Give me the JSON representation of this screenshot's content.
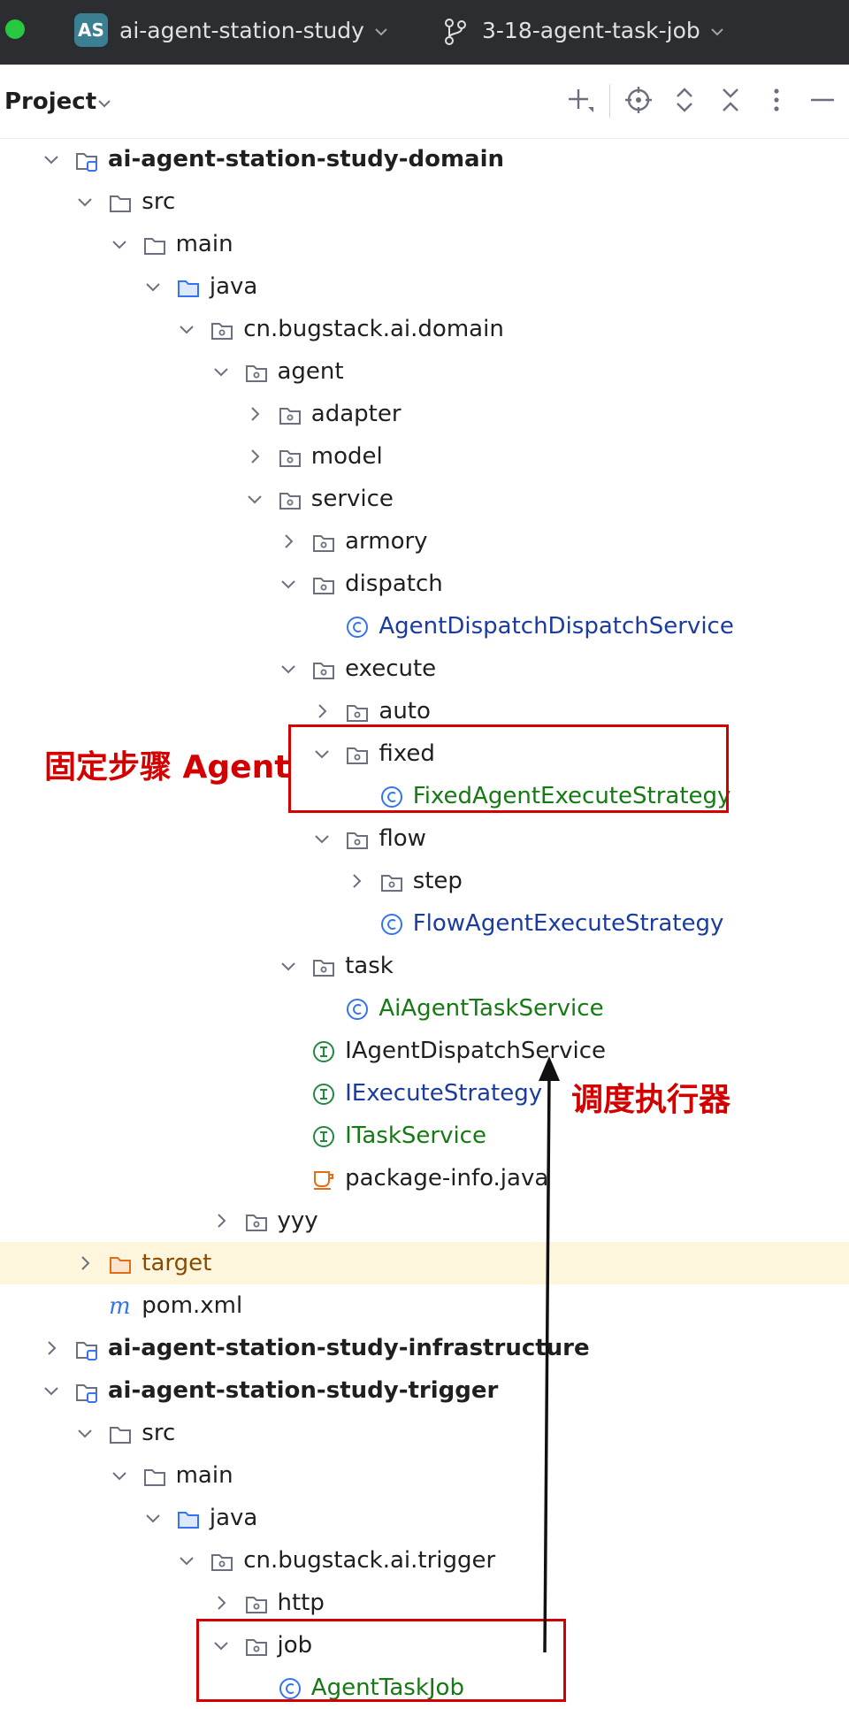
{
  "titlebar": {
    "project_badge": "AS",
    "project_name": "ai-agent-station-study",
    "branch_name": "3-18-agent-task-job"
  },
  "toolbar": {
    "title": "Project",
    "icons": [
      "add-icon",
      "locate-icon",
      "expand-all-icon",
      "collapse-all-icon",
      "more-icon",
      "minimize-icon"
    ]
  },
  "tree": [
    {
      "label": "ai-agent-station-study-domain",
      "depth": 0,
      "expanded": true,
      "icon": "module",
      "style": "bold"
    },
    {
      "label": "src",
      "depth": 1,
      "expanded": true,
      "icon": "folder"
    },
    {
      "label": "main",
      "depth": 2,
      "expanded": true,
      "icon": "folder"
    },
    {
      "label": "java",
      "depth": 3,
      "expanded": true,
      "icon": "source-folder"
    },
    {
      "label": "cn.bugstack.ai.domain",
      "depth": 4,
      "expanded": true,
      "icon": "package"
    },
    {
      "label": "agent",
      "depth": 5,
      "expanded": true,
      "icon": "package"
    },
    {
      "label": "adapter",
      "depth": 6,
      "expanded": false,
      "icon": "package"
    },
    {
      "label": "model",
      "depth": 6,
      "expanded": false,
      "icon": "package"
    },
    {
      "label": "service",
      "depth": 6,
      "expanded": true,
      "icon": "package"
    },
    {
      "label": "armory",
      "depth": 7,
      "expanded": false,
      "icon": "package"
    },
    {
      "label": "dispatch",
      "depth": 7,
      "expanded": true,
      "icon": "package"
    },
    {
      "label": "AgentDispatchDispatchService",
      "depth": 8,
      "icon": "class",
      "style": "blue"
    },
    {
      "label": "execute",
      "depth": 7,
      "expanded": true,
      "icon": "package"
    },
    {
      "label": "auto",
      "depth": 8,
      "expanded": false,
      "icon": "package"
    },
    {
      "label": "fixed",
      "depth": 8,
      "expanded": true,
      "icon": "package"
    },
    {
      "label": "FixedAgentExecuteStrategy",
      "depth": 9,
      "icon": "class",
      "style": "green"
    },
    {
      "label": "flow",
      "depth": 8,
      "expanded": true,
      "icon": "package"
    },
    {
      "label": "step",
      "depth": 9,
      "expanded": false,
      "icon": "package"
    },
    {
      "label": "FlowAgentExecuteStrategy",
      "depth": 9,
      "icon": "class",
      "style": "blue"
    },
    {
      "label": "task",
      "depth": 7,
      "expanded": true,
      "icon": "package"
    },
    {
      "label": "AiAgentTaskService",
      "depth": 8,
      "icon": "class",
      "style": "green"
    },
    {
      "label": "IAgentDispatchService",
      "depth": 7,
      "icon": "interface"
    },
    {
      "label": "IExecuteStrategy",
      "depth": 7,
      "icon": "interface",
      "style": "blue"
    },
    {
      "label": "ITaskService",
      "depth": 7,
      "icon": "interface",
      "style": "green"
    },
    {
      "label": "package-info.java",
      "depth": 7,
      "icon": "java-file"
    },
    {
      "label": "yyy",
      "depth": 5,
      "expanded": false,
      "icon": "package"
    },
    {
      "label": "target",
      "depth": 1,
      "expanded": false,
      "icon": "excluded-folder",
      "style": "orange",
      "highlight": true
    },
    {
      "label": "pom.xml",
      "depth": 1,
      "icon": "maven"
    },
    {
      "label": "ai-agent-station-study-infrastructure",
      "depth": 0,
      "expanded": false,
      "icon": "module",
      "style": "bold"
    },
    {
      "label": "ai-agent-station-study-trigger",
      "depth": 0,
      "expanded": true,
      "icon": "module",
      "style": "bold"
    },
    {
      "label": "src",
      "depth": 1,
      "expanded": true,
      "icon": "folder"
    },
    {
      "label": "main",
      "depth": 2,
      "expanded": true,
      "icon": "folder"
    },
    {
      "label": "java",
      "depth": 3,
      "expanded": true,
      "icon": "source-folder"
    },
    {
      "label": "cn.bugstack.ai.trigger",
      "depth": 4,
      "expanded": true,
      "icon": "package"
    },
    {
      "label": "http",
      "depth": 5,
      "expanded": false,
      "icon": "package"
    },
    {
      "label": "job",
      "depth": 5,
      "expanded": true,
      "icon": "package"
    },
    {
      "label": "AgentTaskJob",
      "depth": 6,
      "icon": "class",
      "style": "green"
    }
  ],
  "annotations": {
    "fixed_label": "固定步骤 Agent",
    "dispatch_label": "调度执行器",
    "color": "#d40000"
  }
}
